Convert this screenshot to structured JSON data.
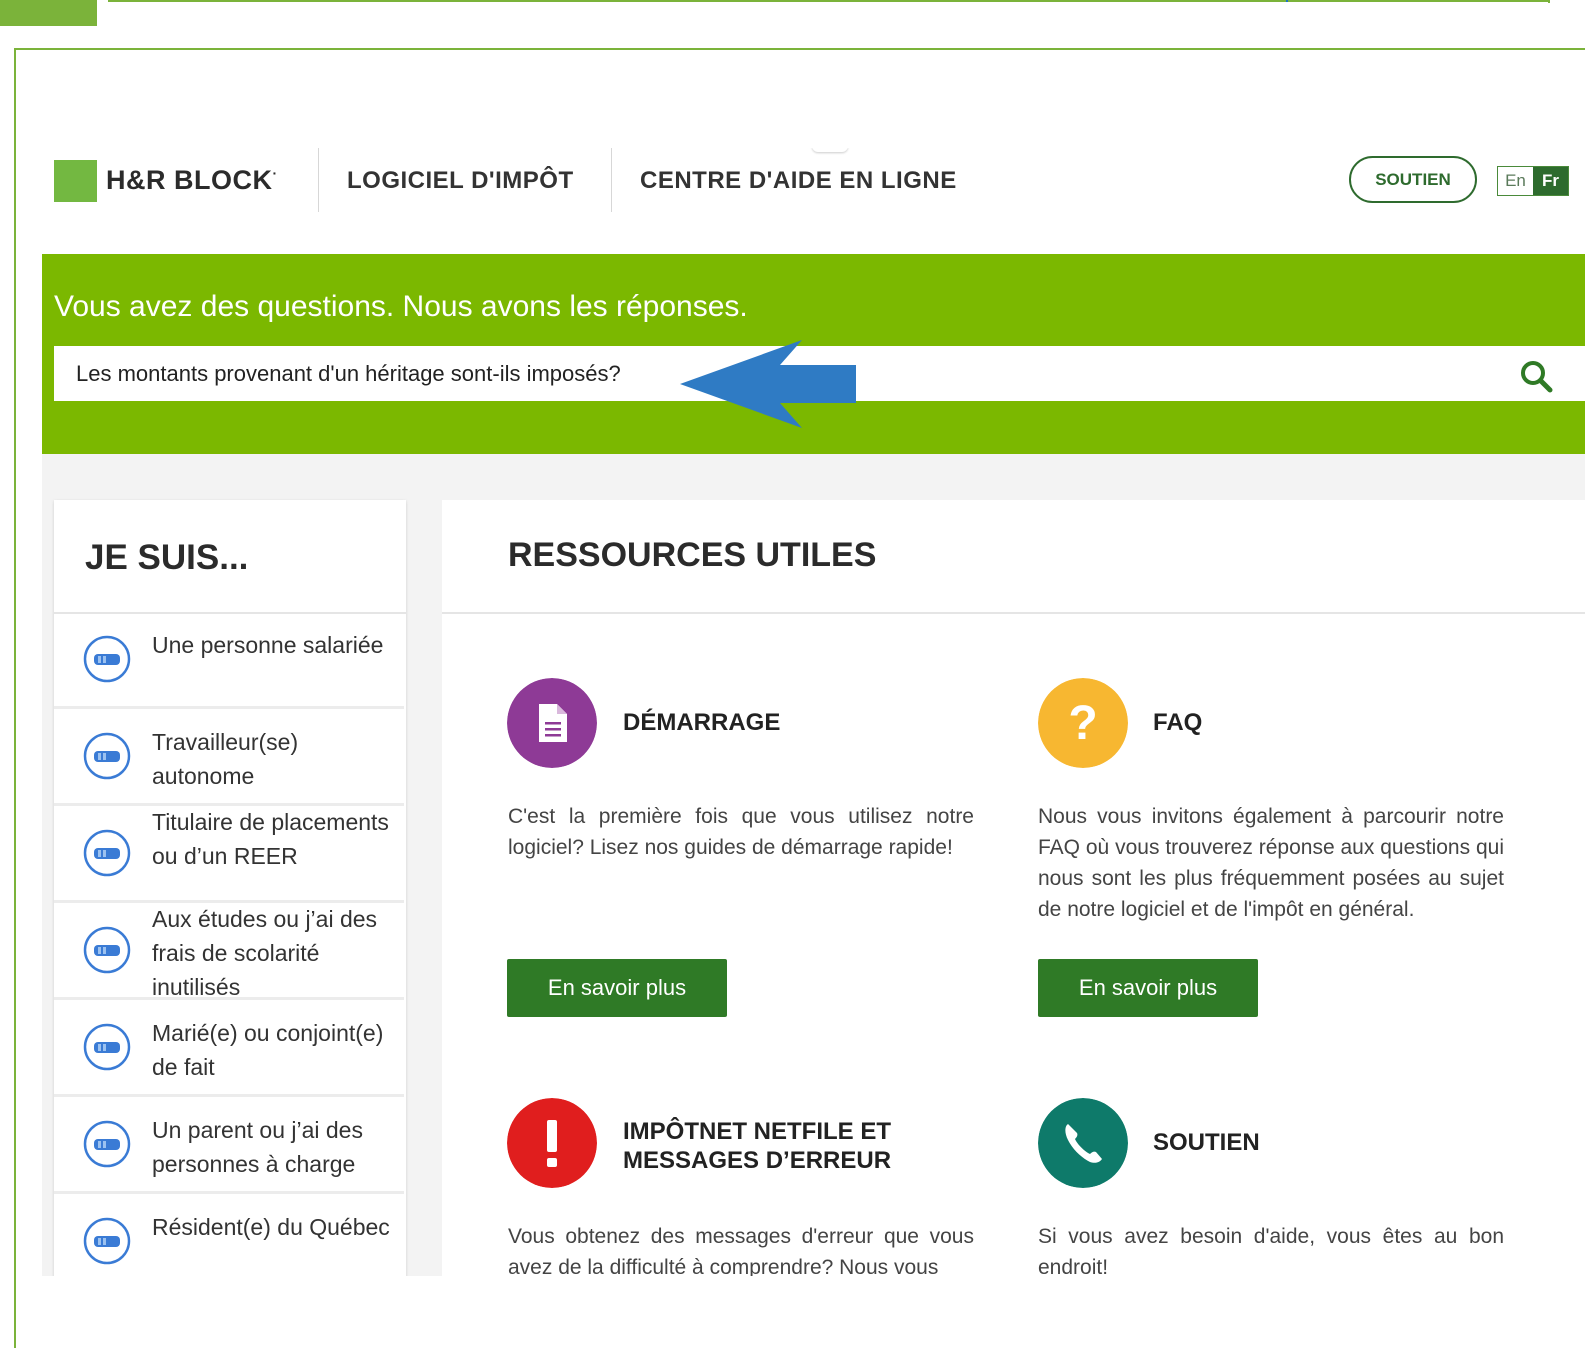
{
  "nav": {
    "brand": "H&R BLOCK",
    "brand_mark": "·",
    "links": [
      "LOGICIEL D'IMPÔT",
      "CENTRE D'AIDE EN LIGNE"
    ],
    "support_label": "SOUTIEN",
    "lang_en": "En",
    "lang_fr": "Fr"
  },
  "hero": {
    "title": "Vous avez des questions. Nous avons les réponses.",
    "search_value": "Les montants provenant d'un héritage sont-ils imposés?"
  },
  "sidebar": {
    "title": "JE SUIS...",
    "items": [
      {
        "label": "Une personne salariée"
      },
      {
        "label": "Travailleur(se) autonome"
      },
      {
        "label": "Titulaire de placements ou d’un REER"
      },
      {
        "label": "Aux études ou j’ai des frais de scolarité inutilisés"
      },
      {
        "label": "Marié(e) ou conjoint(e) de fait"
      },
      {
        "label": "Un parent ou j’ai des personnes à charge"
      },
      {
        "label": "Résident(e) du Québec"
      }
    ]
  },
  "main": {
    "title": "RESSOURCES UTILES",
    "cards": [
      {
        "title": "DÉMARRAGE",
        "desc": "C'est la première fois que vous utilisez notre logiciel? Lisez nos guides de démarrage rapide!",
        "button": "En savoir plus",
        "icon": "document-icon",
        "color": "#8e3a96"
      },
      {
        "title": "FAQ",
        "desc": "Nous vous invitons également à parcourir notre FAQ où vous trouverez réponse aux questions qui nous sont les plus fréquemment posées au sujet de notre logiciel et de l'impôt en général.",
        "button": "En savoir plus",
        "icon": "question-icon",
        "color": "#f7b731"
      },
      {
        "title": "IMPÔTNET NETFILE ET MESSAGES D’ERREUR",
        "desc": "Vous obtenez des messages d'erreur que vous avez de la difficulté à comprendre? Nous vous",
        "icon": "exclamation-icon",
        "color": "#e01e1e"
      },
      {
        "title": "SOUTIEN",
        "desc": "Si vous avez besoin d'aide, vous êtes au bon endroit!",
        "icon": "phone-icon",
        "color": "#0e7a6a"
      }
    ]
  },
  "colors": {
    "brand_green": "#7bb800",
    "button_green": "#2f7a26",
    "annotation_arrow": "#2f7bc4"
  }
}
